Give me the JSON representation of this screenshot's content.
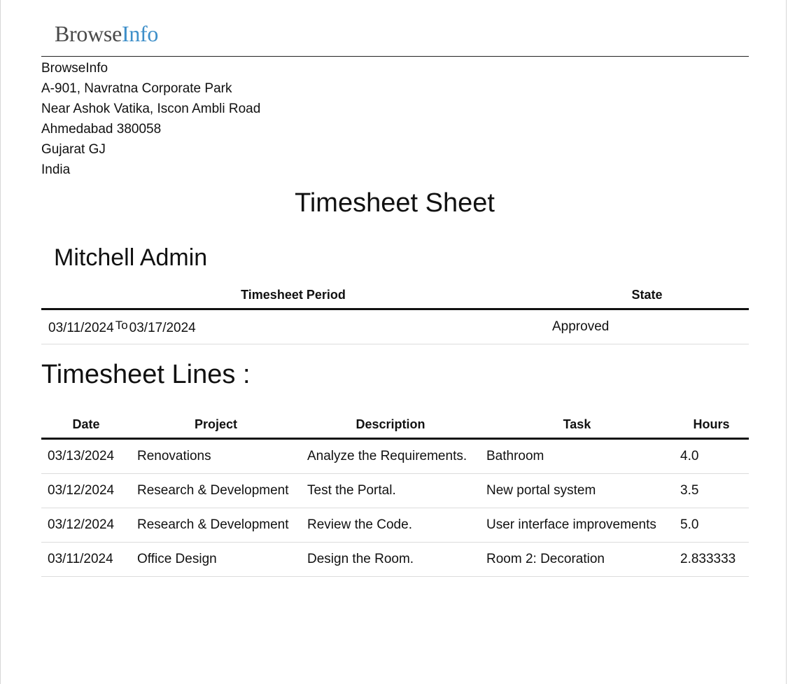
{
  "logo": {
    "part1": "Browse",
    "part2": "Info"
  },
  "company": {
    "lines": [
      "BrowseInfo",
      "A-901, Navratna Corporate Park",
      "Near Ashok Vatika, Iscon Ambli Road",
      "Ahmedabad 380058",
      "Gujarat GJ",
      "India"
    ]
  },
  "title": "Timesheet Sheet",
  "employee_name": "Mitchell Admin",
  "period_table": {
    "headers": {
      "period": "Timesheet Period",
      "state": "State"
    },
    "row": {
      "start": "03/11/2024",
      "to": "To",
      "end": "03/17/2024",
      "state": "Approved"
    }
  },
  "lines_title": "Timesheet Lines :",
  "lines_table": {
    "headers": [
      "Date",
      "Project",
      "Description",
      "Task",
      "Hours"
    ],
    "rows": [
      [
        "03/13/2024",
        "Renovations",
        "Analyze the Requirements.",
        "Bathroom",
        "4.0"
      ],
      [
        "03/12/2024",
        "Research & Development",
        "Test the Portal.",
        "New portal system",
        "3.5"
      ],
      [
        "03/12/2024",
        "Research & Development",
        "Review the Code.",
        "User interface improvements",
        "5.0"
      ],
      [
        "03/11/2024",
        "Office Design",
        "Design the Room.",
        "Room 2: Decoration",
        "2.833333"
      ]
    ]
  },
  "colors": {
    "logo_primary": "#4a4a4a",
    "logo_accent": "#3e8fc9"
  }
}
